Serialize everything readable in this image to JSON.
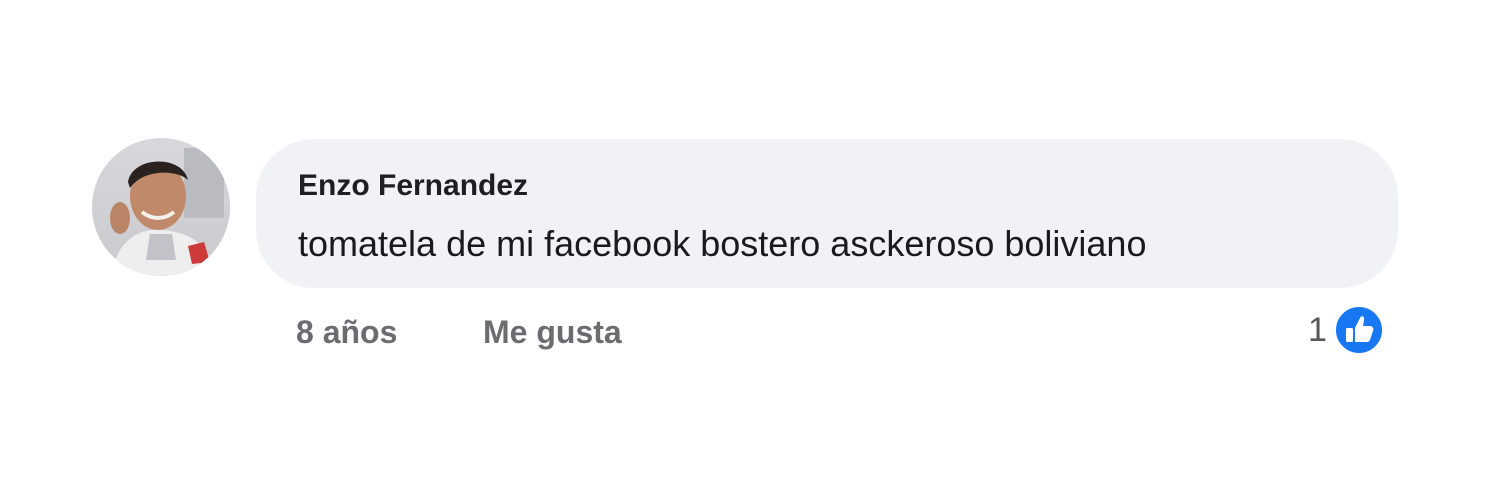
{
  "comment": {
    "author": "Enzo Fernandez",
    "text": "tomatela de mi facebook bostero asckeroso boliviano",
    "time": "8 años",
    "like_label": "Me gusta",
    "reaction_count": "1",
    "reaction_icon": "thumbs-up-icon",
    "avatar_icon": "profile-photo"
  },
  "colors": {
    "bubble": "#f0f2f5",
    "like_blue": "#1877f2",
    "meta_text": "#6a6c70"
  }
}
